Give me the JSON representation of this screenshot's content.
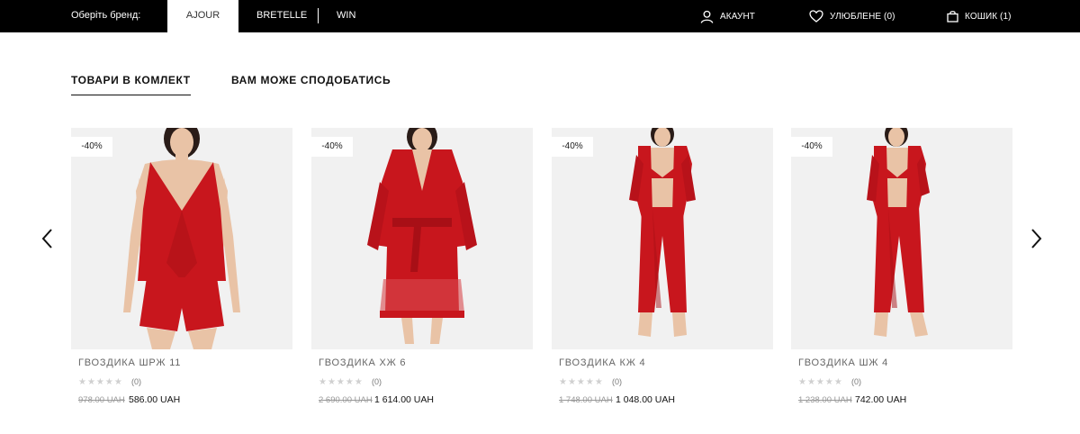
{
  "topbar": {
    "brand_label": "Оберіть бренд:",
    "brands": [
      "AJOUR",
      "BRETELLE",
      "WIN"
    ],
    "account": "АКАУНТ",
    "favorites": "УЛЮБЛЕНЕ (0)",
    "cart": "КОШИК (1)"
  },
  "tabs": [
    "ТОВАРИ В КОМЛЕКТ",
    "ВАМ МОЖЕ СПОДОБАТИСЬ"
  ],
  "products": [
    {
      "badge": "-40%",
      "name": "ГВОЗДИКА ШРЖ 11",
      "stars": "★★★★★",
      "reviews": "(0)",
      "old_price": "978.00 UAH",
      "new_price": "586.00 UAH"
    },
    {
      "badge": "-40%",
      "name": "ГВОЗДИКА ХЖ 6",
      "stars": "★★★★★",
      "reviews": "(0)",
      "old_price": "2 690.00 UAH",
      "new_price": "1 614.00 UAH"
    },
    {
      "badge": "-40%",
      "name": "ГВОЗДИКА КЖ 4",
      "stars": "★★★★★",
      "reviews": "(0)",
      "old_price": "1 748.00 UAH",
      "new_price": "1 048.00 UAH"
    },
    {
      "badge": "-40%",
      "name": "ГВОЗДИКА ШЖ 4",
      "stars": "★★★★★",
      "reviews": "(0)",
      "old_price": "1 238.00 UAH",
      "new_price": "742.00 UAH"
    }
  ],
  "colors": {
    "topbar": "#000000",
    "product_red": "#c8161d",
    "photo_bg": "#f1f1f1",
    "skin": "#e9c3a6"
  }
}
